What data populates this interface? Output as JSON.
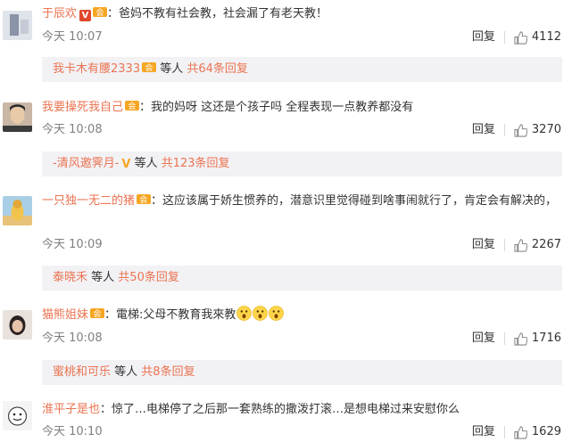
{
  "comments": [
    {
      "user": "于辰欢",
      "badge": "V",
      "sep": "：",
      "text": "爸妈不教有社会教，社会漏了有老天教！",
      "time": "今天 10:07",
      "reply_label": "回复",
      "likes": "4112",
      "sub": {
        "user": "我卡木有腰2333",
        "suffix": " 等人",
        "count_text": "共64条回复"
      }
    },
    {
      "user": "我要操死我自己",
      "sep": "：",
      "text": "我的妈呀 这还是个孩子吗  全程表现一点教养都没有",
      "time": "今天 10:08",
      "reply_label": "回复",
      "likes": "3270",
      "sub": {
        "user": "-清风邀霁月-",
        "badge": "V",
        "suffix": " 等人",
        "count_text": "共123条回复"
      }
    },
    {
      "user": "一只独一无二的猪",
      "sep": "：",
      "text": "这应该属于娇生惯养的，潜意识里觉得碰到啥事闹就行了，肯定会有解决的，",
      "time": "今天 10:09",
      "reply_label": "回复",
      "likes": "2267",
      "sub": {
        "user": "泰晓禾",
        "suffix": " 等人",
        "count_text": "共50条回复"
      }
    },
    {
      "user": "猫熊姐妹",
      "sep": "：",
      "text": "電梯:父母不教育我來教",
      "time": "今天 10:08",
      "reply_label": "回复",
      "likes": "1716",
      "sub": {
        "user": "蜜桃和可乐",
        "suffix": " 等人",
        "count_text": "共8条回复"
      }
    },
    {
      "user": "淮平子是也",
      "sep": "：",
      "text": "惊了…电梯停了之后那一套熟练的撒泼打滚…是想电梯过来安慰你么",
      "time": "今天 10:10",
      "reply_label": "回复",
      "likes": "1629"
    }
  ]
}
